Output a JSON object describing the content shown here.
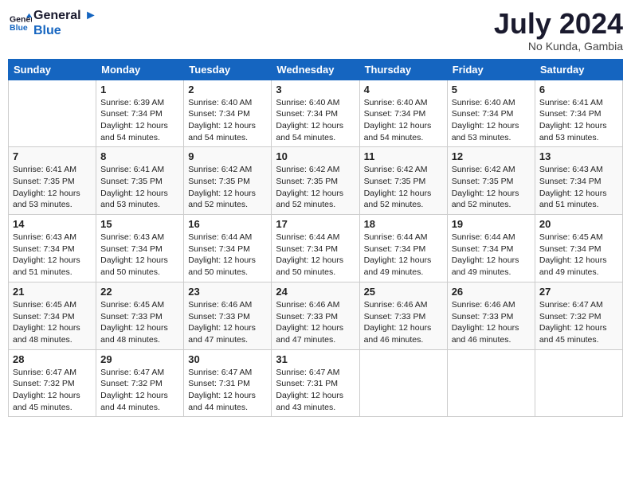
{
  "logo": {
    "line1": "General",
    "line2": "Blue"
  },
  "title": "July 2024",
  "location": "No Kunda, Gambia",
  "days_of_week": [
    "Sunday",
    "Monday",
    "Tuesday",
    "Wednesday",
    "Thursday",
    "Friday",
    "Saturday"
  ],
  "weeks": [
    [
      {
        "date": "",
        "info": ""
      },
      {
        "date": "1",
        "info": "Sunrise: 6:39 AM\nSunset: 7:34 PM\nDaylight: 12 hours\nand 54 minutes."
      },
      {
        "date": "2",
        "info": "Sunrise: 6:40 AM\nSunset: 7:34 PM\nDaylight: 12 hours\nand 54 minutes."
      },
      {
        "date": "3",
        "info": "Sunrise: 6:40 AM\nSunset: 7:34 PM\nDaylight: 12 hours\nand 54 minutes."
      },
      {
        "date": "4",
        "info": "Sunrise: 6:40 AM\nSunset: 7:34 PM\nDaylight: 12 hours\nand 54 minutes."
      },
      {
        "date": "5",
        "info": "Sunrise: 6:40 AM\nSunset: 7:34 PM\nDaylight: 12 hours\nand 53 minutes."
      },
      {
        "date": "6",
        "info": "Sunrise: 6:41 AM\nSunset: 7:34 PM\nDaylight: 12 hours\nand 53 minutes."
      }
    ],
    [
      {
        "date": "7",
        "info": "Sunrise: 6:41 AM\nSunset: 7:35 PM\nDaylight: 12 hours\nand 53 minutes."
      },
      {
        "date": "8",
        "info": "Sunrise: 6:41 AM\nSunset: 7:35 PM\nDaylight: 12 hours\nand 53 minutes."
      },
      {
        "date": "9",
        "info": "Sunrise: 6:42 AM\nSunset: 7:35 PM\nDaylight: 12 hours\nand 52 minutes."
      },
      {
        "date": "10",
        "info": "Sunrise: 6:42 AM\nSunset: 7:35 PM\nDaylight: 12 hours\nand 52 minutes."
      },
      {
        "date": "11",
        "info": "Sunrise: 6:42 AM\nSunset: 7:35 PM\nDaylight: 12 hours\nand 52 minutes."
      },
      {
        "date": "12",
        "info": "Sunrise: 6:42 AM\nSunset: 7:35 PM\nDaylight: 12 hours\nand 52 minutes."
      },
      {
        "date": "13",
        "info": "Sunrise: 6:43 AM\nSunset: 7:34 PM\nDaylight: 12 hours\nand 51 minutes."
      }
    ],
    [
      {
        "date": "14",
        "info": "Sunrise: 6:43 AM\nSunset: 7:34 PM\nDaylight: 12 hours\nand 51 minutes."
      },
      {
        "date": "15",
        "info": "Sunrise: 6:43 AM\nSunset: 7:34 PM\nDaylight: 12 hours\nand 50 minutes."
      },
      {
        "date": "16",
        "info": "Sunrise: 6:44 AM\nSunset: 7:34 PM\nDaylight: 12 hours\nand 50 minutes."
      },
      {
        "date": "17",
        "info": "Sunrise: 6:44 AM\nSunset: 7:34 PM\nDaylight: 12 hours\nand 50 minutes."
      },
      {
        "date": "18",
        "info": "Sunrise: 6:44 AM\nSunset: 7:34 PM\nDaylight: 12 hours\nand 49 minutes."
      },
      {
        "date": "19",
        "info": "Sunrise: 6:44 AM\nSunset: 7:34 PM\nDaylight: 12 hours\nand 49 minutes."
      },
      {
        "date": "20",
        "info": "Sunrise: 6:45 AM\nSunset: 7:34 PM\nDaylight: 12 hours\nand 49 minutes."
      }
    ],
    [
      {
        "date": "21",
        "info": "Sunrise: 6:45 AM\nSunset: 7:34 PM\nDaylight: 12 hours\nand 48 minutes."
      },
      {
        "date": "22",
        "info": "Sunrise: 6:45 AM\nSunset: 7:33 PM\nDaylight: 12 hours\nand 48 minutes."
      },
      {
        "date": "23",
        "info": "Sunrise: 6:46 AM\nSunset: 7:33 PM\nDaylight: 12 hours\nand 47 minutes."
      },
      {
        "date": "24",
        "info": "Sunrise: 6:46 AM\nSunset: 7:33 PM\nDaylight: 12 hours\nand 47 minutes."
      },
      {
        "date": "25",
        "info": "Sunrise: 6:46 AM\nSunset: 7:33 PM\nDaylight: 12 hours\nand 46 minutes."
      },
      {
        "date": "26",
        "info": "Sunrise: 6:46 AM\nSunset: 7:33 PM\nDaylight: 12 hours\nand 46 minutes."
      },
      {
        "date": "27",
        "info": "Sunrise: 6:47 AM\nSunset: 7:32 PM\nDaylight: 12 hours\nand 45 minutes."
      }
    ],
    [
      {
        "date": "28",
        "info": "Sunrise: 6:47 AM\nSunset: 7:32 PM\nDaylight: 12 hours\nand 45 minutes."
      },
      {
        "date": "29",
        "info": "Sunrise: 6:47 AM\nSunset: 7:32 PM\nDaylight: 12 hours\nand 44 minutes."
      },
      {
        "date": "30",
        "info": "Sunrise: 6:47 AM\nSunset: 7:31 PM\nDaylight: 12 hours\nand 44 minutes."
      },
      {
        "date": "31",
        "info": "Sunrise: 6:47 AM\nSunset: 7:31 PM\nDaylight: 12 hours\nand 43 minutes."
      },
      {
        "date": "",
        "info": ""
      },
      {
        "date": "",
        "info": ""
      },
      {
        "date": "",
        "info": ""
      }
    ]
  ]
}
